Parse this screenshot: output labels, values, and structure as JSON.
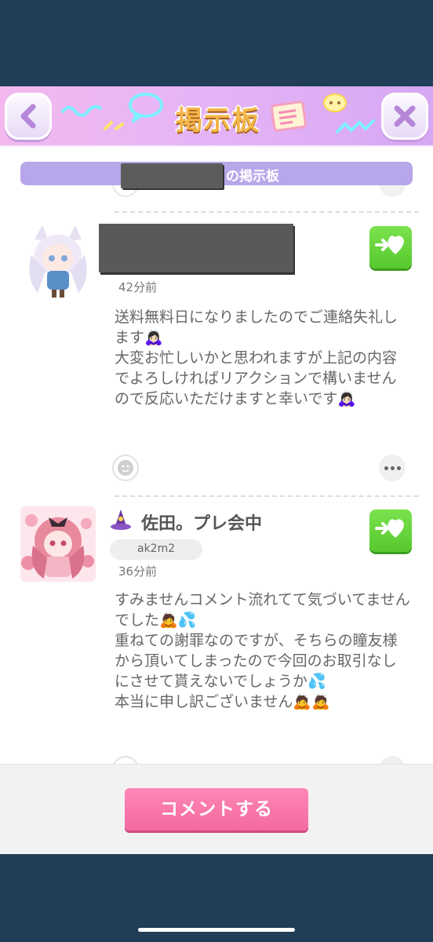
{
  "header": {
    "title": "掲示板",
    "back_icon": "chevron-left-icon",
    "close_icon": "close-icon"
  },
  "board": {
    "label": "の掲示板"
  },
  "posts": [
    {
      "time": "42分前",
      "message": "送料無料日になりましたのでご連絡失礼します🙇🏻‍♀️\n大変お忙しいかと思われますが上記の内容でよろしければリアクションで構いませんので反応いただけますと幸いです🙇🏻‍♀️"
    },
    {
      "name": "佐田。プレ会中",
      "user_id": "ak2m2",
      "time": "36分前",
      "message": "すみませんコメント流れてて気づいてませんでした🙇💦\n重ねての謝罪なのですが、そちらの瞳友様から頂いてしまったので今回のお取引なしにさせて貰えないでしょうか💦\n本当に申し訳ございません🙇🙇"
    }
  ],
  "footer": {
    "comment_label": "コメントする"
  },
  "colors": {
    "header_gradient": "#e6b4f6",
    "board_bar": "#b8a6ea",
    "react_green": "#57c82e",
    "comment_pink": "#f36a9f",
    "frame": "#203e57"
  }
}
